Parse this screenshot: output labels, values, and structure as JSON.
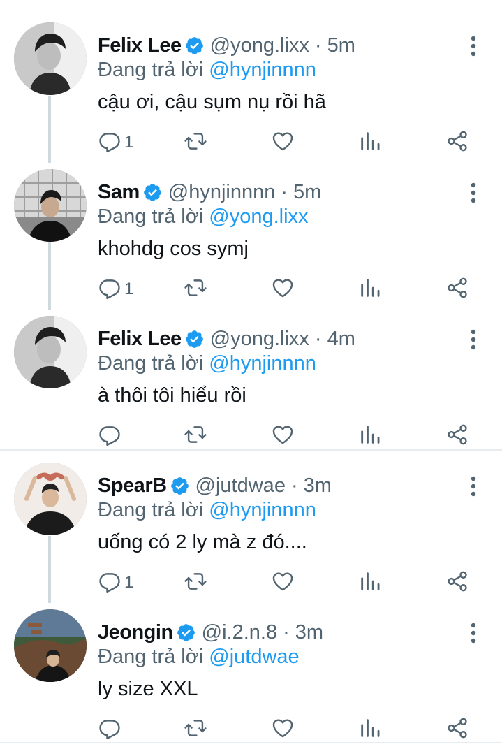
{
  "colors": {
    "accent": "#1d9bf0",
    "muted": "#536471",
    "text": "#0f1419",
    "verified": "#1d9bf0"
  },
  "icons": {
    "verified": "verified-badge-icon",
    "more": "more-vertical-icon",
    "reply": "reply-icon",
    "retweet": "retweet-icon",
    "like": "heart-icon",
    "views": "views-bar-chart-icon",
    "share": "share-icon"
  },
  "tweets": [
    {
      "name": "Felix Lee",
      "handle": "@yong.lixx",
      "separator": "·",
      "time": "5m",
      "reply_prefix": "Đang trả lời",
      "reply_to": "@hynjinnnn",
      "text": "cậu ơi, cậu sụm nụ rồi hã",
      "reply_count": "1"
    },
    {
      "name": "Sam",
      "handle": "@hynjinnnn",
      "separator": "·",
      "time": "5m",
      "reply_prefix": "Đang trả lời",
      "reply_to": "@yong.lixx",
      "text": "khohdg cos symj",
      "reply_count": "1"
    },
    {
      "name": "Felix Lee",
      "handle": "@yong.lixx",
      "separator": "·",
      "time": "4m",
      "reply_prefix": "Đang trả lời",
      "reply_to": "@hynjinnnn",
      "text": "à thôi tôi hiểu rồi",
      "reply_count": ""
    },
    {
      "name": "SpearB",
      "handle": "@jutdwae",
      "separator": "·",
      "time": "3m",
      "reply_prefix": "Đang trả lời",
      "reply_to": "@hynjinnnn",
      "text": "uống có 2 ly mà z đó....",
      "reply_count": "1"
    },
    {
      "name": "Jeongin",
      "handle": "@i.2.n.8",
      "separator": "·",
      "time": "3m",
      "reply_prefix": "Đang trả lời",
      "reply_to": "@jutdwae",
      "text": "ly size XXL",
      "reply_count": ""
    }
  ]
}
